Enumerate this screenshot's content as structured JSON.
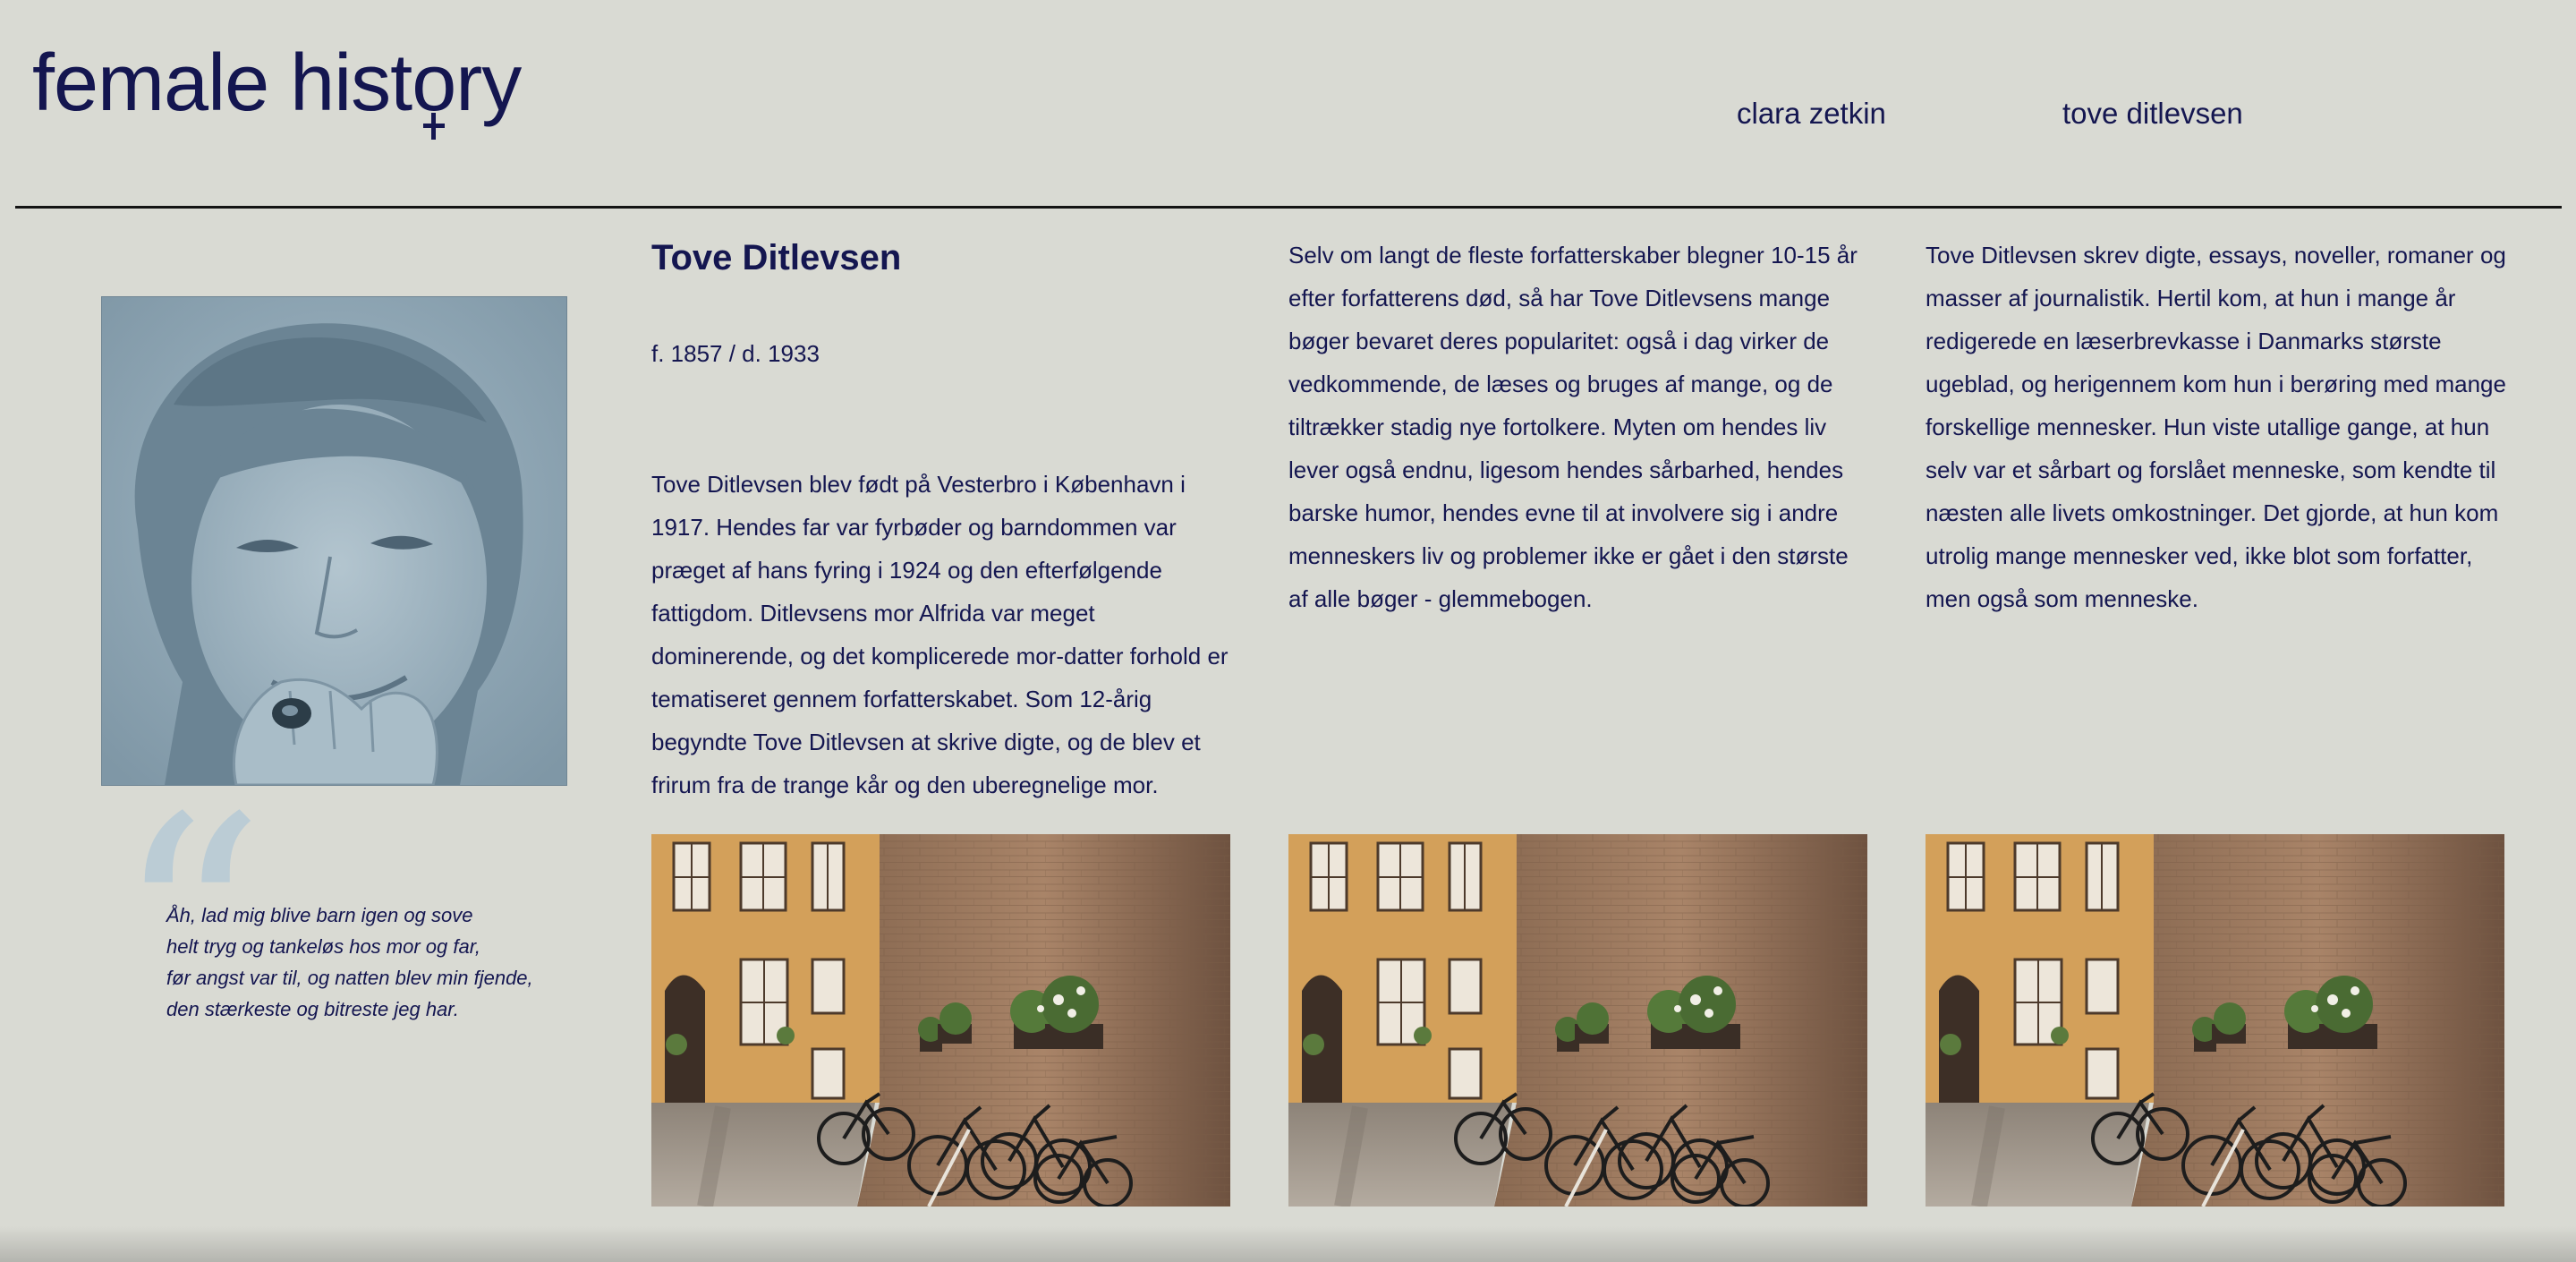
{
  "header": {
    "logo_text_before": "female hist",
    "logo_text_o": "o",
    "logo_text_after": "ry",
    "nav": [
      {
        "label": "clara zetkin"
      },
      {
        "label": "tove ditlevsen"
      }
    ]
  },
  "sidebar": {
    "portrait_alt": "portrait",
    "quote_mark": "“",
    "quote_lines": [
      "Åh, lad mig blive barn igen og sove",
      "helt tryg og tankeløs hos mor og far,",
      "før angst var til, og natten blev min fjende,",
      "den stærkeste og bitreste jeg har."
    ]
  },
  "article": {
    "title": "Tove Ditlevsen",
    "dates": "f. 1857 / d. 1933",
    "col1_paragraph": "Tove Ditlevsen blev født på Vesterbro i København i 1917. Hendes far var fyrbøder og barndommen var præget af hans fyring i 1924 og den efterfølgende fattigdom. Ditlevsens mor Alfrida var meget dominerende, og det komplicerede mor-datter forhold er tematiseret gennem forfatterskabet. Som 12-årig begyndte Tove Ditlevsen at skrive digte, og de blev et frirum fra de trange kår og den uberegnelige mor.",
    "col2_paragraph": "Selv om langt de fleste forfatterskaber blegner 10-15 år efter forfatterens død, så har Tove Ditlevsens mange bøger bevaret deres popularitet: også i dag virker de vedkommende, de læses og bruges af mange, og de tiltrækker stadig nye fortolkere. Myten om hendes liv lever også endnu, ligesom hendes sårbarhed, hendes barske humor, hendes evne til at involvere sig i andre menneskers liv og problemer ikke er gået i den største af alle bøger - glemmebogen.",
    "col3_paragraph": "Tove Ditlevsen skrev digte, essays, noveller, romaner og masser af journalistik. Hertil kom, at hun i mange år redigerede en læserbrevkasse i Danmarks største ugeblad, og herigennem kom hun i berøring med mange forskellige mennesker. Hun viste utallige gange, at hun selv var et sårbart og forslået menneske, som kendte til næsten alle livets omkostninger. Det gjorde, at hun kom utrolig mange mennesker ved, ikke blot som forfatter, men også som menneske."
  },
  "colors": {
    "background": "#d9dad3",
    "text": "#141650",
    "portrait_tint": "#8fa7b5",
    "quote_mark": "#b6cad6"
  },
  "icons": [
    "venus-symbol-icon",
    "quote-mark-icon"
  ]
}
